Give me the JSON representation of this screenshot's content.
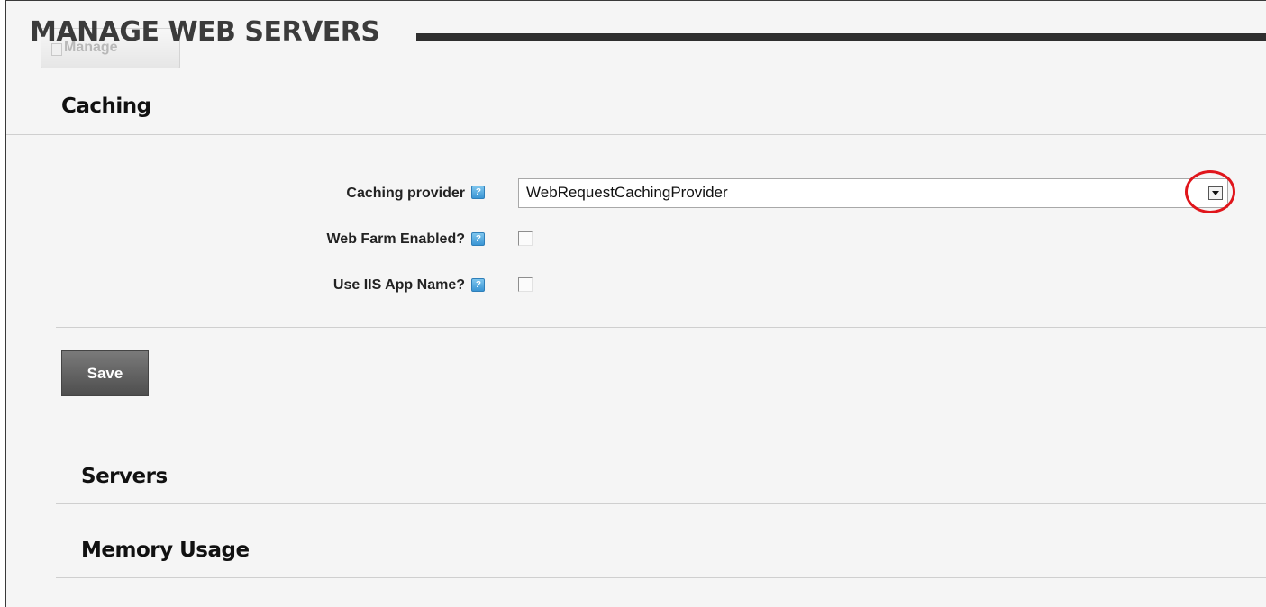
{
  "page": {
    "title": "MANAGE WEB SERVERS",
    "background_button_label": "Manage"
  },
  "caching": {
    "heading": "Caching",
    "provider_label": "Caching provider",
    "provider_value": "WebRequestCachingProvider",
    "web_farm_label": "Web Farm Enabled?",
    "web_farm_checked": false,
    "iis_app_label": "Use IIS App Name?",
    "iis_app_checked": false,
    "help_glyph": "?",
    "save_label": "Save"
  },
  "sections": {
    "servers": "Servers",
    "memory_usage": "Memory Usage"
  },
  "colors": {
    "highlight_circle": "#e0151b",
    "help_icon": "#3a95d4",
    "save_button": "#5c5c5c"
  },
  "icons": {
    "help": "help-icon",
    "dropdown": "chevron-down-icon",
    "manage": "manage-icon"
  }
}
